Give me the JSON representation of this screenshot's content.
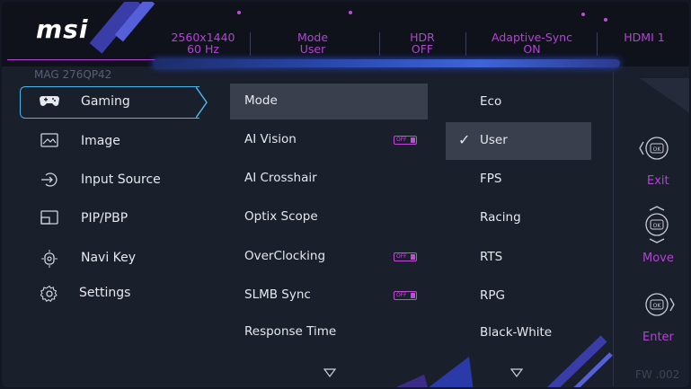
{
  "brand": {
    "logo": "msi",
    "model": "MAG 276QP42"
  },
  "status_bar": [
    {
      "line1": "2560x1440",
      "line2": "60 Hz"
    },
    {
      "line1": "Mode",
      "line2": "User"
    },
    {
      "line1": "HDR",
      "line2": "OFF"
    },
    {
      "line1": "Adaptive-Sync",
      "line2": "ON"
    },
    {
      "line1": "HDMI 1",
      "line2": ""
    }
  ],
  "menu": [
    {
      "label": "Gaming",
      "icon": "gamepad-icon",
      "active": true
    },
    {
      "label": "Image",
      "icon": "image-icon"
    },
    {
      "label": "Input Source",
      "icon": "input-source-icon"
    },
    {
      "label": "PIP/PBP",
      "icon": "pip-icon"
    },
    {
      "label": "Navi Key",
      "icon": "navi-key-icon"
    },
    {
      "label": "Settings",
      "icon": "gear-icon"
    }
  ],
  "gaming_options": [
    {
      "label": "Mode",
      "selected": true
    },
    {
      "label": "AI Vision",
      "toggle": "OFF"
    },
    {
      "label": "AI Crosshair"
    },
    {
      "label": "Optix Scope"
    },
    {
      "label": "OverClocking",
      "toggle": "OFF"
    },
    {
      "label": "SLMB Sync",
      "toggle": "OFF"
    },
    {
      "label": "Response Time"
    }
  ],
  "mode_options": [
    {
      "label": "Eco"
    },
    {
      "label": "User",
      "selected": true
    },
    {
      "label": "FPS"
    },
    {
      "label": "Racing"
    },
    {
      "label": "RTS"
    },
    {
      "label": "RPG"
    },
    {
      "label": "Black-White"
    }
  ],
  "key_guide": [
    {
      "label": "Exit",
      "icon": "joystick-left-icon"
    },
    {
      "label": "Move",
      "icon": "joystick-updown-icon"
    },
    {
      "label": "Enter",
      "icon": "joystick-right-icon",
      "key": "OK"
    }
  ],
  "firmware": "FW .002",
  "colors": {
    "accent_magenta": "#b443d6",
    "accent_blue": "#4ab4e8",
    "background": "#1a1f2c",
    "selected_row": "#3a3f4e"
  }
}
